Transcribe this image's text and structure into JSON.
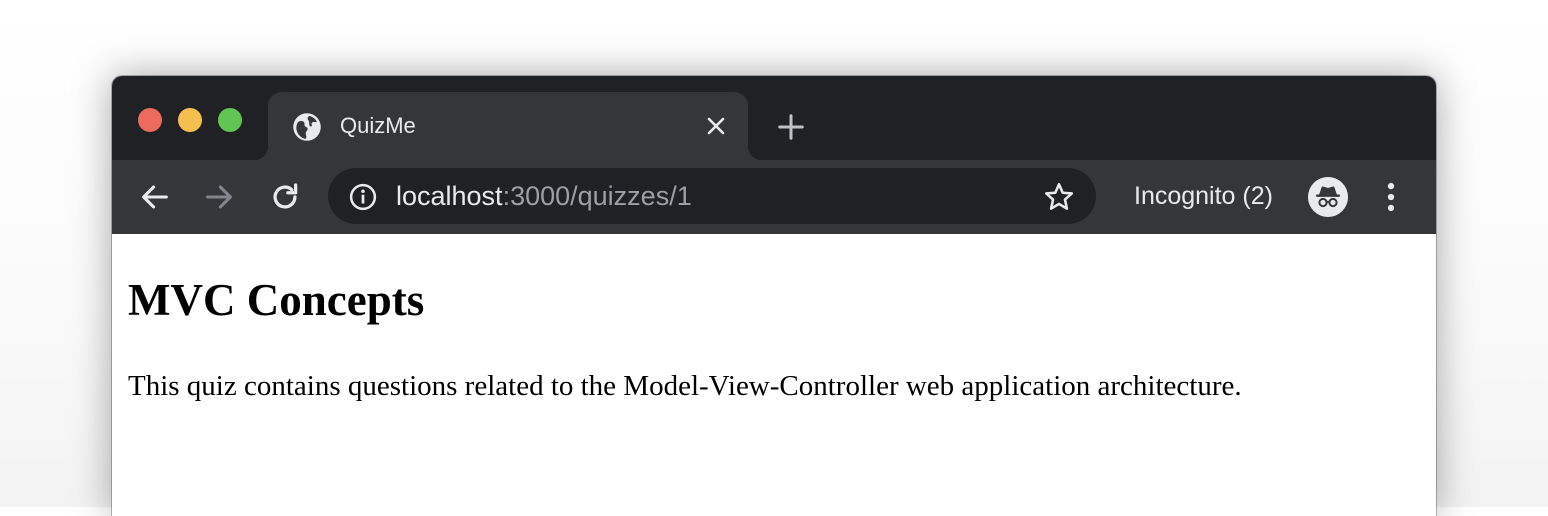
{
  "browser": {
    "tab": {
      "title": "QuizMe",
      "favicon": "globe-icon"
    },
    "address_bar": {
      "host": "localhost",
      "path": ":3000/quizzes/1"
    },
    "profile": {
      "label": "Incognito (2)",
      "icon": "incognito-icon"
    },
    "colors": {
      "titlebar": "#202124",
      "toolbar": "#35363a",
      "omnibox": "#202124",
      "traffic_close": "#ed6a5e",
      "traffic_minimize": "#f5bf4f",
      "traffic_maximize": "#61c554"
    }
  },
  "page": {
    "title": "MVC Concepts",
    "description": "This quiz contains questions related to the Model-View-Controller web application architecture."
  }
}
